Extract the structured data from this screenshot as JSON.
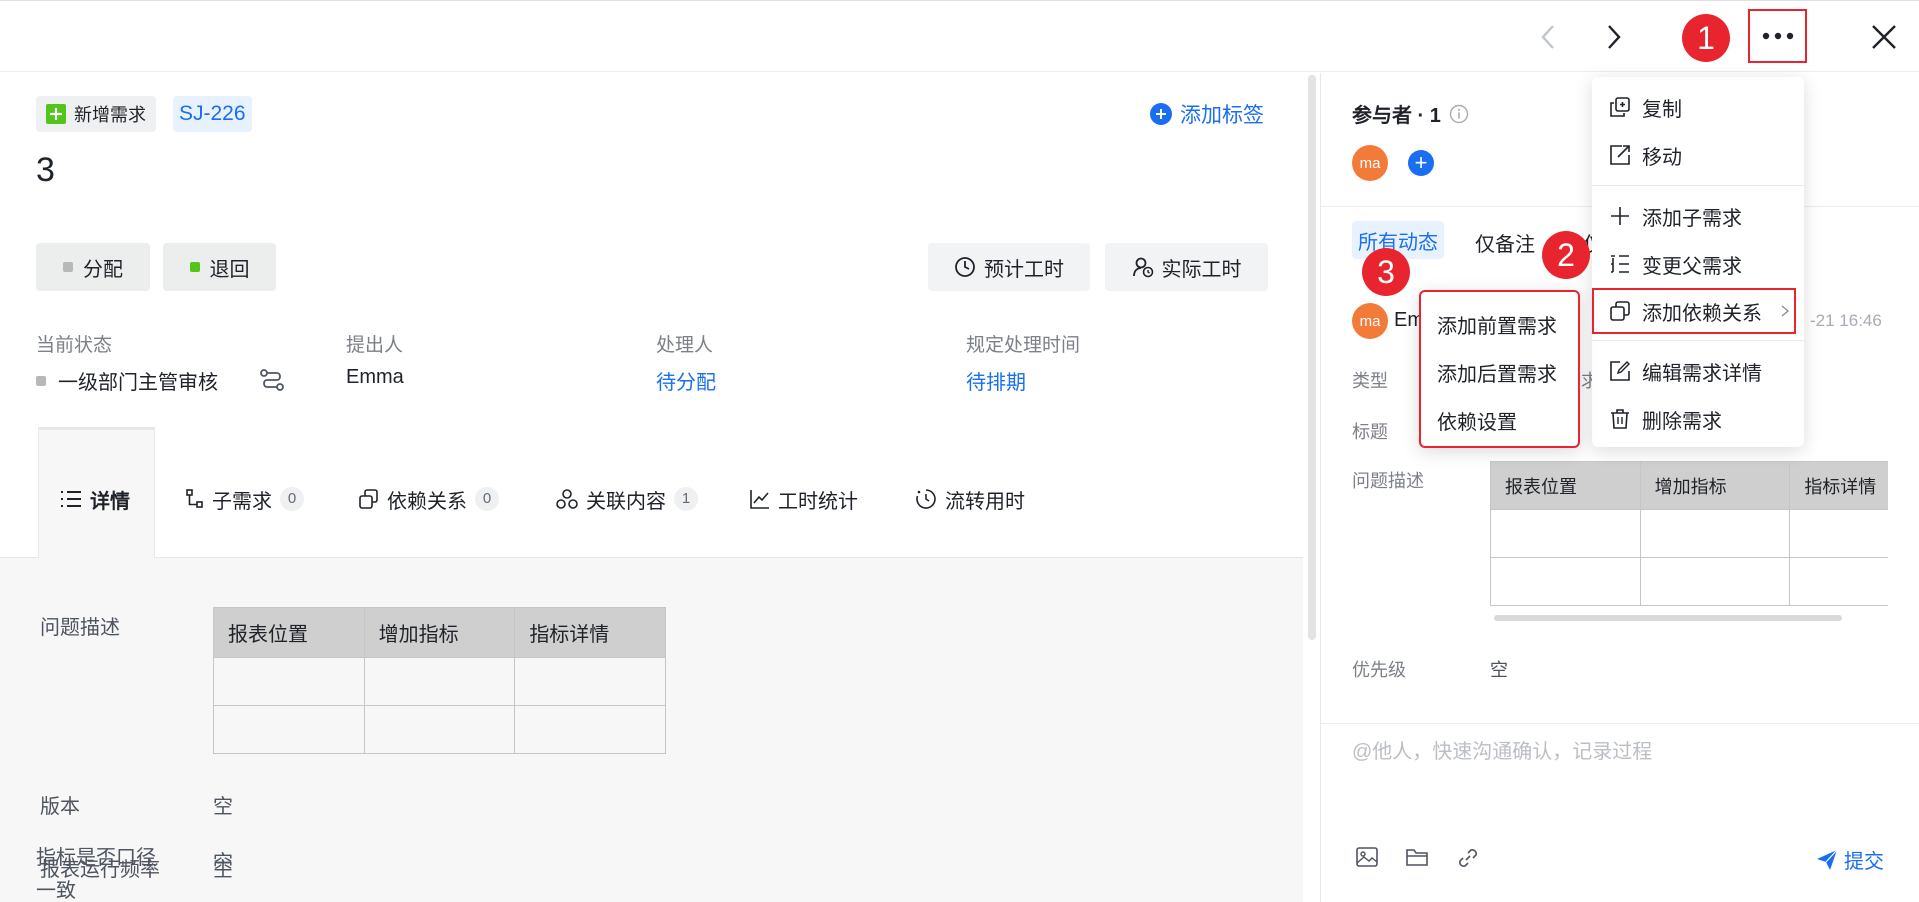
{
  "markers": [
    "1",
    "2",
    "3"
  ],
  "header": {
    "type_tag": "新增需求",
    "id": "SJ-226",
    "add_tag": "添加标签",
    "title": "3"
  },
  "actions": {
    "assign": "分配",
    "reject": "退回",
    "estimated_hours": "预计工时",
    "actual_hours": "实际工时"
  },
  "info": {
    "status_label": "当前状态",
    "status_value": "一级部门主管审核",
    "creator_label": "提出人",
    "creator_value": "Emma",
    "handler_label": "处理人",
    "handler_value": "待分配",
    "deadline_label": "规定处理时间",
    "deadline_value": "待排期"
  },
  "tabs": [
    {
      "label": "详情",
      "count": ""
    },
    {
      "label": "子需求",
      "count": "0"
    },
    {
      "label": "依赖关系",
      "count": "0"
    },
    {
      "label": "关联内容",
      "count": "1"
    },
    {
      "label": "工时统计",
      "count": ""
    },
    {
      "label": "流转用时",
      "count": ""
    }
  ],
  "details": {
    "desc_label": "问题描述",
    "table_headers": [
      "报表位置",
      "增加指标",
      "指标详情"
    ],
    "version_label": "版本",
    "version_value": "空",
    "freq_label": "报表运行频率",
    "freq_value": "空",
    "consistent_label_1": "指标是否口径",
    "consistent_label_2": "一致",
    "consistent_value": "空"
  },
  "right": {
    "participants": "参与者 · 1",
    "avatar_initials": "ma",
    "activity_tabs": [
      "所有动态",
      "仅备注",
      "仅"
    ],
    "activity_user": "Em",
    "activity_time": "-21 16:46",
    "type_label": "类型",
    "type_value_fragment": "求",
    "title_label": "标题",
    "desc_label": "问题描述",
    "table_headers": [
      "报表位置",
      "增加指标",
      "指标详情"
    ],
    "priority_label": "优先级",
    "priority_value": "空",
    "comment_placeholder": "@他人，快速沟通确认，记录过程",
    "submit": "提交"
  },
  "more_menu": {
    "items": [
      "复制",
      "移动",
      "添加子需求",
      "变更父需求",
      "添加依赖关系",
      "编辑需求详情",
      "删除需求"
    ]
  },
  "dependency_submenu": {
    "items": [
      "添加前置需求",
      "添加后置需求",
      "依赖设置"
    ]
  },
  "colors": {
    "accent": "#1a6ef0",
    "marker": "#e8242f",
    "assign_dot": "#b8b8b8",
    "reject_dot": "#52c41a",
    "avatar": "#f37b3a"
  }
}
